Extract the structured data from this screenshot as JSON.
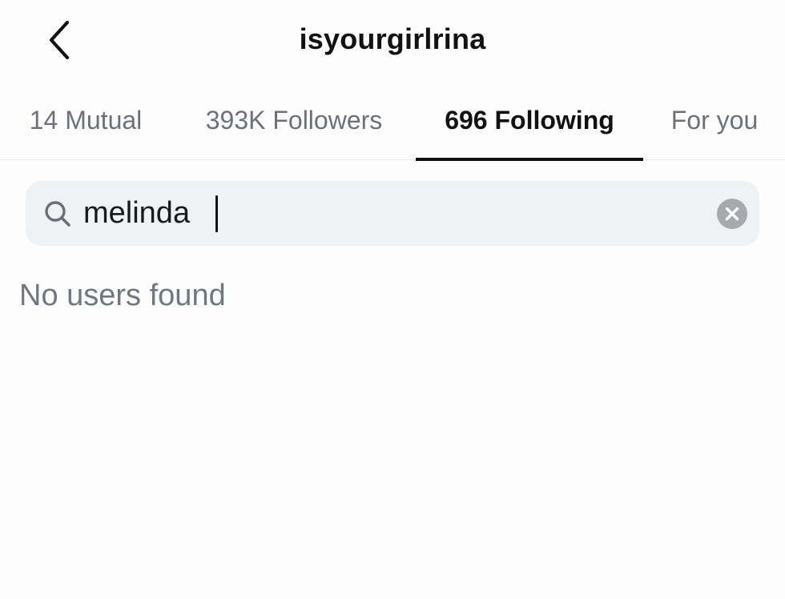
{
  "header": {
    "title": "isyourgirlrina",
    "back_icon": "chevron-left-icon"
  },
  "tabs": [
    {
      "label": "14 Mutual",
      "active": false
    },
    {
      "label": "393K Followers",
      "active": false
    },
    {
      "label": "696 Following",
      "active": true
    },
    {
      "label": "For you",
      "active": false
    }
  ],
  "search": {
    "value": "melinda",
    "icon": "search-icon",
    "clear_icon": "clear-icon"
  },
  "results": {
    "empty_message": "No users found"
  },
  "colors": {
    "background": "#fdfdfd",
    "search_bg": "#eff2f5",
    "active_tab": "#111111",
    "inactive_tab": "#6d7278",
    "muted_text": "#717780",
    "clear_icon_bg": "#a6a9ad"
  }
}
